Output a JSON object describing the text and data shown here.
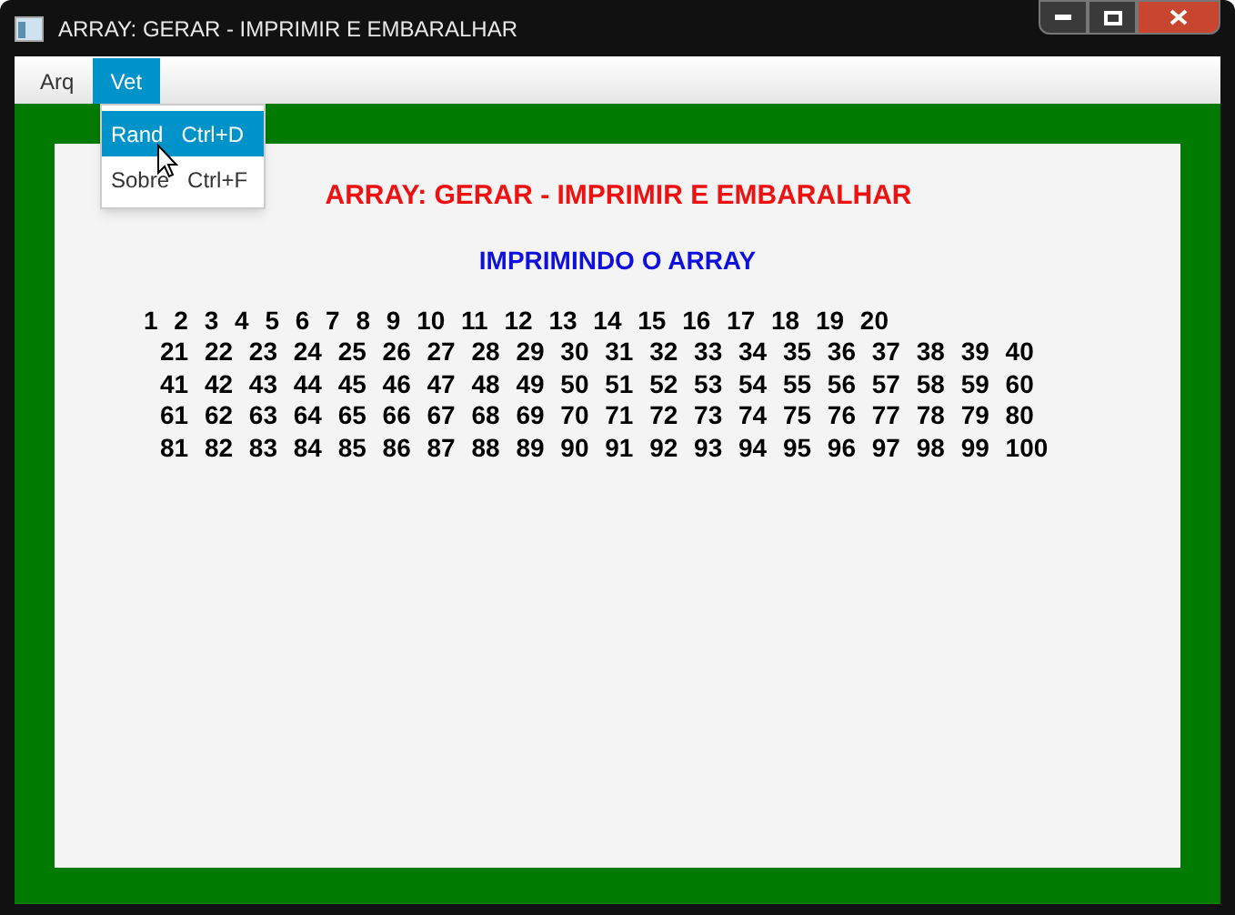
{
  "window": {
    "title": "ARRAY: GERAR - IMPRIMIR E EMBARALHAR"
  },
  "menubar": [
    {
      "label": "Arq",
      "selected": false
    },
    {
      "label": "Vet",
      "selected": true
    }
  ],
  "menu": [
    {
      "label": "Rand",
      "shortcut": "Ctrl+D",
      "selected": true
    },
    {
      "label": "Sobre",
      "shortcut": "Ctrl+F",
      "selected": false
    }
  ],
  "heading": "ARRAY: GERAR - IMPRIMIR E EMBARALHAR",
  "subheading": "IMPRIMINDO O ARRAY",
  "array_lines": [
    "1 2 3 4 5 6 7 8 9 10 11 12 13 14 15 16 17 18 19 20",
    "21 22 23 24 25 26 27 28 29 30 31 32 33 34 35 36 37 38 39 40",
    "41 42 43 44 45 46 47 48 49 50 51 52 53 54 55 56 57 58 59 60",
    "61 62 63 64 65 66 67 68 69 70 71 72 73 74 75 76 77 78 79 80",
    "81 82 83 84 85 86 87 88 89 90 91 92 93 94 95 96 97 98 99 100"
  ]
}
